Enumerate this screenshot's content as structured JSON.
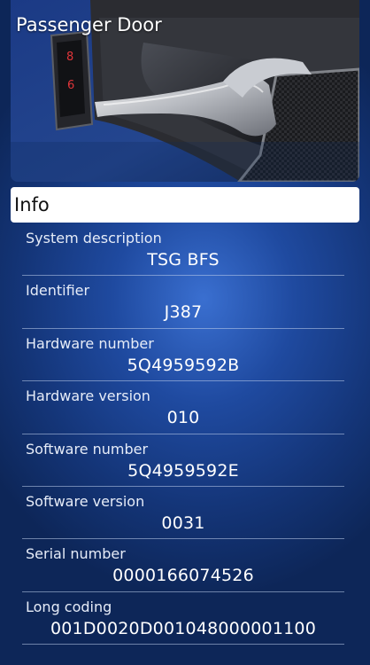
{
  "header": {
    "title": "Passenger Door"
  },
  "info": {
    "title": "Info",
    "rows": [
      {
        "label": "System description",
        "value": "TSG BFS"
      },
      {
        "label": "Identifier",
        "value": "J387"
      },
      {
        "label": "Hardware number",
        "value": "5Q4959592B"
      },
      {
        "label": "Hardware version",
        "value": "010"
      },
      {
        "label": "Software number",
        "value": "5Q4959592E"
      },
      {
        "label": "Software version",
        "value": "0031"
      },
      {
        "label": "Serial number",
        "value": "0000166074526"
      },
      {
        "label": "Long coding",
        "value": "001D0020D001048000001100"
      }
    ]
  },
  "colors": {
    "background_center": "#3a6fd0",
    "background_edge": "#0d2658",
    "info_header_bg": "#ffffff",
    "divider": "#becdeb"
  }
}
